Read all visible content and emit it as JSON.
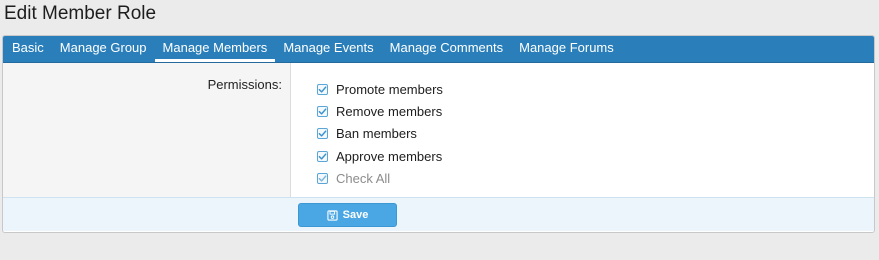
{
  "page": {
    "title": "Edit Member Role"
  },
  "tabs": [
    {
      "label": "Basic",
      "active": false
    },
    {
      "label": "Manage Group",
      "active": false
    },
    {
      "label": "Manage Members",
      "active": true
    },
    {
      "label": "Manage Events",
      "active": false
    },
    {
      "label": "Manage Comments",
      "active": false
    },
    {
      "label": "Manage Forums",
      "active": false
    }
  ],
  "form": {
    "permissions_label": "Permissions:",
    "options": [
      {
        "label": "Promote members",
        "checked": true
      },
      {
        "label": "Remove members",
        "checked": true
      },
      {
        "label": "Ban members",
        "checked": true
      },
      {
        "label": "Approve members",
        "checked": true
      },
      {
        "label": "Check All",
        "checked": true
      }
    ]
  },
  "footer": {
    "save_label": "Save",
    "save_icon": "floppy-disk-icon"
  },
  "colors": {
    "tab_bar": "#2a7fba",
    "save_button": "#4aa7e3",
    "checkbox_border": "#5ba6d6",
    "footer_bg": "#edf5fc"
  }
}
